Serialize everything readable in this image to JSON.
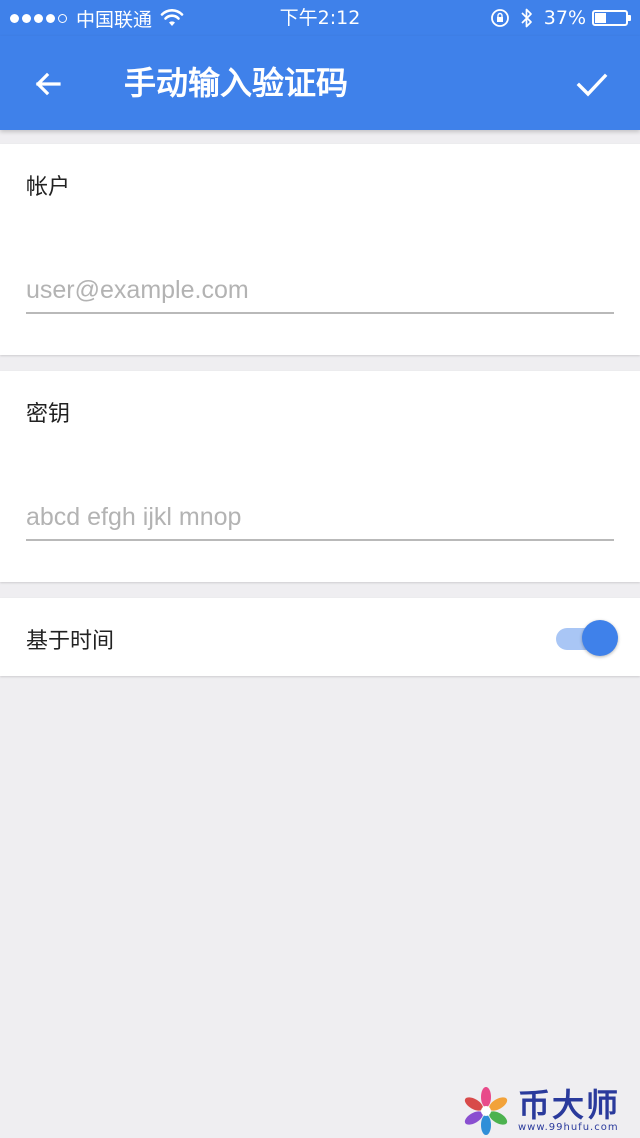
{
  "status_bar": {
    "carrier": "中国联通",
    "time": "下午2:12",
    "battery_percent": "37%",
    "battery_level": 0.37,
    "signal_bars": 4,
    "signal_total": 5
  },
  "app_bar": {
    "title": "手动输入验证码",
    "back_icon": "arrow-left-icon",
    "confirm_icon": "check-icon"
  },
  "account_section": {
    "label": "帐户",
    "input_value": "",
    "input_placeholder": "user@example.com"
  },
  "key_section": {
    "label": "密钥",
    "input_value": "",
    "input_placeholder": "abcd efgh ijkl mnop"
  },
  "time_based_section": {
    "label": "基于时间",
    "toggle_on": true
  },
  "watermark": {
    "brand": "币大师",
    "url": "www.99hufu.com"
  },
  "colors": {
    "primary": "#3f81ea",
    "toggle_track": "#a9c6f5",
    "background": "#efeef1"
  }
}
